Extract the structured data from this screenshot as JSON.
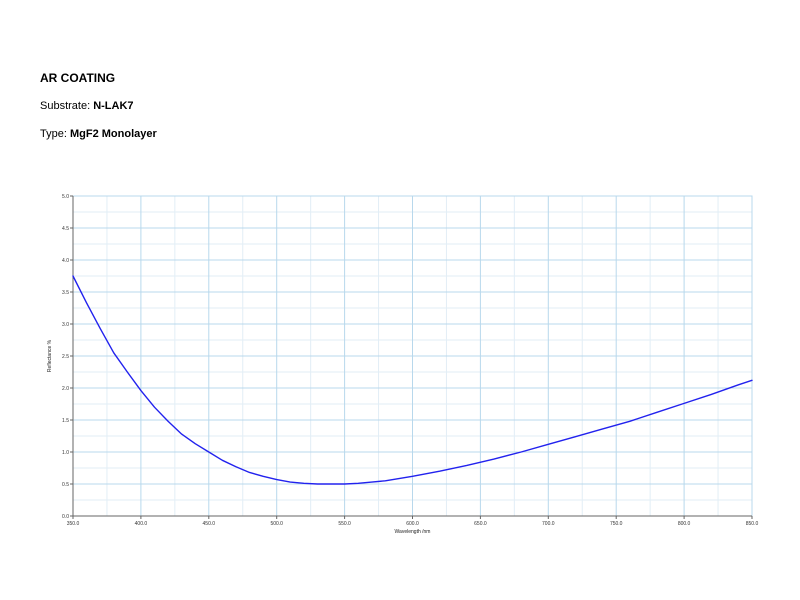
{
  "header": {
    "title": "AR COATING",
    "substrate_label": "Substrate:",
    "substrate_value": "N-LAK7",
    "type_label": "Type:",
    "type_value": "MgF2 Monolayer"
  },
  "colors": {
    "curve": "#2222ee",
    "grid_major": "#b8d8ec",
    "grid_minor": "#e2eef6",
    "axis": "#666666"
  },
  "chart_data": {
    "type": "line",
    "xlabel": "Wavelength /nm",
    "ylabel": "Reflectance %",
    "xlim": [
      350,
      850
    ],
    "ylim": [
      0,
      5
    ],
    "x_ticks": [
      "350.0",
      "400.0",
      "450.0",
      "500.0",
      "550.0",
      "600.0",
      "650.0",
      "700.0",
      "750.0",
      "800.0",
      "850.0"
    ],
    "y_ticks": [
      "0.0",
      "0.5",
      "1.0",
      "1.5",
      "2.0",
      "2.5",
      "3.0",
      "3.5",
      "4.0",
      "4.5",
      "5.0"
    ],
    "grid": true,
    "series": [
      {
        "x": [
          350,
          360,
          370,
          380,
          390,
          400,
          410,
          420,
          430,
          440,
          450,
          460,
          470,
          480,
          490,
          500,
          510,
          520,
          530,
          540,
          550,
          560,
          570,
          580,
          600,
          620,
          640,
          660,
          680,
          700,
          720,
          740,
          760,
          780,
          800,
          820,
          840,
          850
        ],
        "y": [
          3.75,
          3.33,
          2.93,
          2.55,
          2.25,
          1.96,
          1.7,
          1.48,
          1.28,
          1.13,
          1.0,
          0.87,
          0.77,
          0.68,
          0.62,
          0.57,
          0.53,
          0.51,
          0.5,
          0.5,
          0.5,
          0.51,
          0.53,
          0.55,
          0.62,
          0.7,
          0.79,
          0.89,
          1.0,
          1.12,
          1.24,
          1.36,
          1.48,
          1.62,
          1.76,
          1.9,
          2.05,
          2.12
        ]
      }
    ]
  }
}
